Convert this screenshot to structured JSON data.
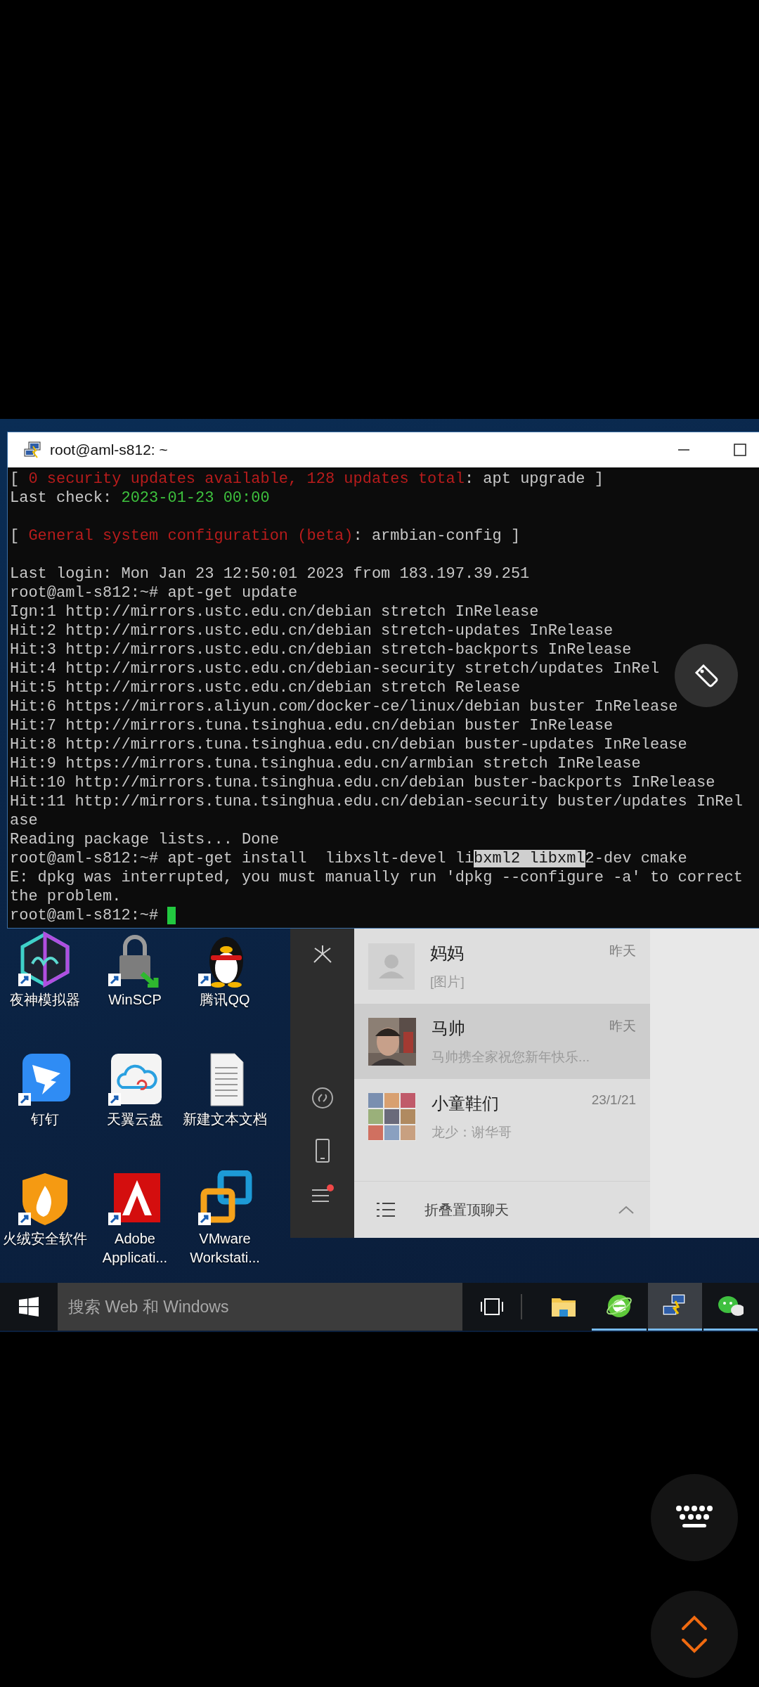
{
  "terminal": {
    "title": "root@aml-s812: ~",
    "cursor": true,
    "lines": [
      {
        "kind": "text",
        "segments": [
          {
            "text": "[ ",
            "kind": "plain"
          },
          {
            "text": "0 security updates available, 128 updates total",
            "kind": "red"
          },
          {
            "text": ": apt upgrade ]",
            "kind": "plain"
          }
        ]
      },
      {
        "kind": "text",
        "segments": [
          {
            "text": "Last check: ",
            "kind": "plain"
          },
          {
            "text": "2023-01-23 00:00",
            "kind": "green"
          }
        ]
      },
      {
        "kind": "blank"
      },
      {
        "kind": "text",
        "segments": [
          {
            "text": "[ ",
            "kind": "plain"
          },
          {
            "text": "General system configuration (beta)",
            "kind": "red"
          },
          {
            "text": ": armbian-config ]",
            "kind": "plain"
          }
        ]
      },
      {
        "kind": "blank"
      },
      {
        "kind": "text",
        "segments": [
          {
            "text": "Last login: Mon Jan 23 12:50:01 2023 from 183.197.39.251",
            "kind": "plain"
          }
        ]
      },
      {
        "kind": "text",
        "segments": [
          {
            "text": "root@aml-s812:~# apt-get update",
            "kind": "plain"
          }
        ]
      },
      {
        "kind": "text",
        "segments": [
          {
            "text": "Ign:1 http://mirrors.ustc.edu.cn/debian stretch InRelease",
            "kind": "plain"
          }
        ]
      },
      {
        "kind": "text",
        "segments": [
          {
            "text": "Hit:2 http://mirrors.ustc.edu.cn/debian stretch-updates InRelease",
            "kind": "plain"
          }
        ]
      },
      {
        "kind": "text",
        "segments": [
          {
            "text": "Hit:3 http://mirrors.ustc.edu.cn/debian stretch-backports InRelease",
            "kind": "plain"
          }
        ]
      },
      {
        "kind": "text",
        "segments": [
          {
            "text": "Hit:4 http://mirrors.ustc.edu.cn/debian-security stretch/updates InRel",
            "kind": "plain"
          }
        ]
      },
      {
        "kind": "text",
        "segments": [
          {
            "text": "Hit:5 http://mirrors.ustc.edu.cn/debian stretch Release",
            "kind": "plain"
          }
        ]
      },
      {
        "kind": "text",
        "segments": [
          {
            "text": "Hit:6 https://mirrors.aliyun.com/docker-ce/linux/debian buster InRelease",
            "kind": "plain"
          }
        ]
      },
      {
        "kind": "text",
        "segments": [
          {
            "text": "Hit:7 http://mirrors.tuna.tsinghua.edu.cn/debian buster InRelease",
            "kind": "plain"
          }
        ]
      },
      {
        "kind": "text",
        "segments": [
          {
            "text": "Hit:8 http://mirrors.tuna.tsinghua.edu.cn/debian buster-updates InRelease",
            "kind": "plain"
          }
        ]
      },
      {
        "kind": "text",
        "segments": [
          {
            "text": "Hit:9 https://mirrors.tuna.tsinghua.edu.cn/armbian stretch InRelease",
            "kind": "plain"
          }
        ]
      },
      {
        "kind": "text",
        "segments": [
          {
            "text": "Hit:10 http://mirrors.tuna.tsinghua.edu.cn/debian buster-backports InRelease",
            "kind": "plain"
          }
        ]
      },
      {
        "kind": "text",
        "segments": [
          {
            "text": "Hit:11 http://mirrors.tuna.tsinghua.edu.cn/debian-security buster/updates InRel",
            "kind": "plain"
          }
        ]
      },
      {
        "kind": "text",
        "segments": [
          {
            "text": "ase",
            "kind": "plain"
          }
        ]
      },
      {
        "kind": "text",
        "segments": [
          {
            "text": "Reading package lists... Done",
            "kind": "plain"
          }
        ]
      },
      {
        "kind": "text",
        "segments": [
          {
            "text": "root@aml-s812:~# apt-get install  libxslt-devel li",
            "kind": "plain"
          },
          {
            "text": "bxml2 libxml",
            "kind": "highlight"
          },
          {
            "text": "2-dev cmake",
            "kind": "plain"
          }
        ]
      },
      {
        "kind": "text",
        "segments": [
          {
            "text": "E: dpkg was interrupted, you must manually run 'dpkg --configure -a' to correct",
            "kind": "plain"
          }
        ]
      },
      {
        "kind": "text",
        "segments": [
          {
            "text": "the problem.",
            "kind": "plain"
          }
        ]
      },
      {
        "kind": "text",
        "segments": [
          {
            "text": "root@aml-s812:~# ",
            "kind": "plain"
          }
        ]
      }
    ]
  },
  "desktop_icons": [
    {
      "label": "夜神模拟器",
      "kind": "hexagon"
    },
    {
      "label": "WinSCP",
      "kind": "padlock"
    },
    {
      "label": "腾讯QQ",
      "kind": "penguin"
    },
    {
      "label": "钉钉",
      "kind": "wing"
    },
    {
      "label": "天翼云盘",
      "kind": "cloud"
    },
    {
      "label": "新建文本文档",
      "kind": "document"
    },
    {
      "label": "火绒安全软件",
      "kind": "shield"
    },
    {
      "label": "Adobe Applicati...",
      "kind": "triangle"
    },
    {
      "label": "VMware Workstati...",
      "kind": "squares"
    }
  ],
  "chat": {
    "conversations": [
      {
        "name": "妈妈",
        "preview": "[图片]",
        "time": "昨天",
        "kind": "default",
        "selected": false
      },
      {
        "name": "马帅",
        "preview": "马帅携全家祝您新年快乐...",
        "time": "昨天",
        "selected": true
      },
      {
        "name": "小童鞋们",
        "preview": "龙少：谢华哥",
        "time": "23/1/21",
        "kind": "group",
        "selected": false
      }
    ],
    "footer": "折叠置顶聊天",
    "notification_dot": true
  },
  "taskbar": {
    "search_placeholder": "搜索 Web 和 Windows",
    "apps": [
      {
        "kind": "folder",
        "running": false,
        "selected": false
      },
      {
        "kind": "browser",
        "running": true,
        "selected": false
      },
      {
        "kind": "terminal",
        "running": true,
        "selected": true
      },
      {
        "kind": "chat",
        "running": true,
        "selected": false
      }
    ]
  }
}
